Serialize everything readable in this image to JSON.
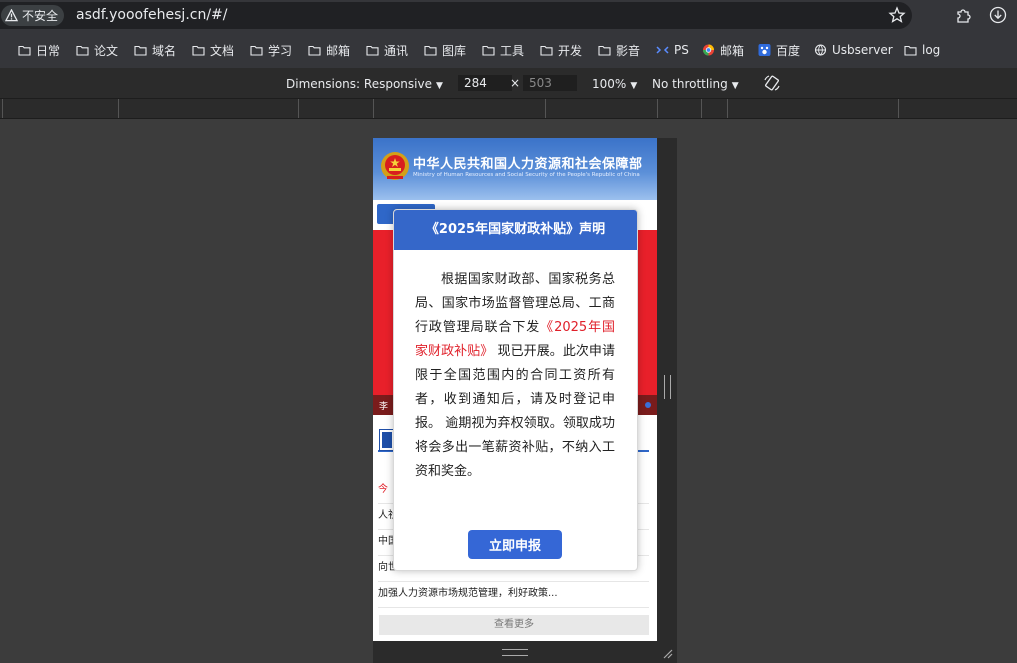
{
  "browser": {
    "security_label": "不安全",
    "url": "asdf.yooofehesj.cn/#/"
  },
  "bookmarks": [
    {
      "label": "日常",
      "icon": "folder-icon"
    },
    {
      "label": "论文",
      "icon": "folder-icon"
    },
    {
      "label": "域名",
      "icon": "folder-icon"
    },
    {
      "label": "文档",
      "icon": "folder-icon"
    },
    {
      "label": "学习",
      "icon": "folder-icon"
    },
    {
      "label": "邮箱",
      "icon": "folder-icon"
    },
    {
      "label": "通讯",
      "icon": "folder-icon"
    },
    {
      "label": "图库",
      "icon": "folder-icon"
    },
    {
      "label": "工具",
      "icon": "folder-icon"
    },
    {
      "label": "开发",
      "icon": "folder-icon"
    },
    {
      "label": "影音",
      "icon": "folder-icon"
    },
    {
      "label": "PS",
      "icon": "ps-icon"
    },
    {
      "label": "邮箱",
      "icon": "mail-site-icon"
    },
    {
      "label": "百度",
      "icon": "baidu-icon"
    },
    {
      "label": "Usbserver",
      "icon": "globe-icon"
    },
    {
      "label": "log",
      "icon": "folder-icon"
    }
  ],
  "devtools": {
    "dimensions_label": "Dimensions: Responsive",
    "width_value": "284",
    "times": "×",
    "height_value": "503",
    "zoom": "100%",
    "throttling": "No throttling"
  },
  "site": {
    "title": "中华人民共和国人力资源和社会保障部",
    "subtitle": "Ministry of Human Resources and Social Security of the People's Republic of China",
    "banner_caption": "李",
    "news": [
      "今",
      "人社",
      "中国",
      "向世界展示'技能中国'风采……通往...",
      "加强人力资源市场规范管理，利好政策..."
    ],
    "more_label": "查看更多"
  },
  "modal": {
    "title": "《2025年国家财政补贴》声明",
    "body_part1": "根据国家财政部、国家税务总局、国家市场监督管理总局、工商行政管理局联合下发",
    "body_highlight": "《2025年国家财政补贴》",
    "body_part2": " 现已开展。此次申请限于全国范围内的合同工资所有者，收到通知后，请及时登记申报。 逾期视为弃权领取。领取成功将会多出一笔薪资补贴，不纳入工资和奖金。",
    "button_label": "立即申报"
  },
  "colors": {
    "modal_header": "#3567c9",
    "highlight": "#e0202a",
    "banner": "#e8202a"
  }
}
